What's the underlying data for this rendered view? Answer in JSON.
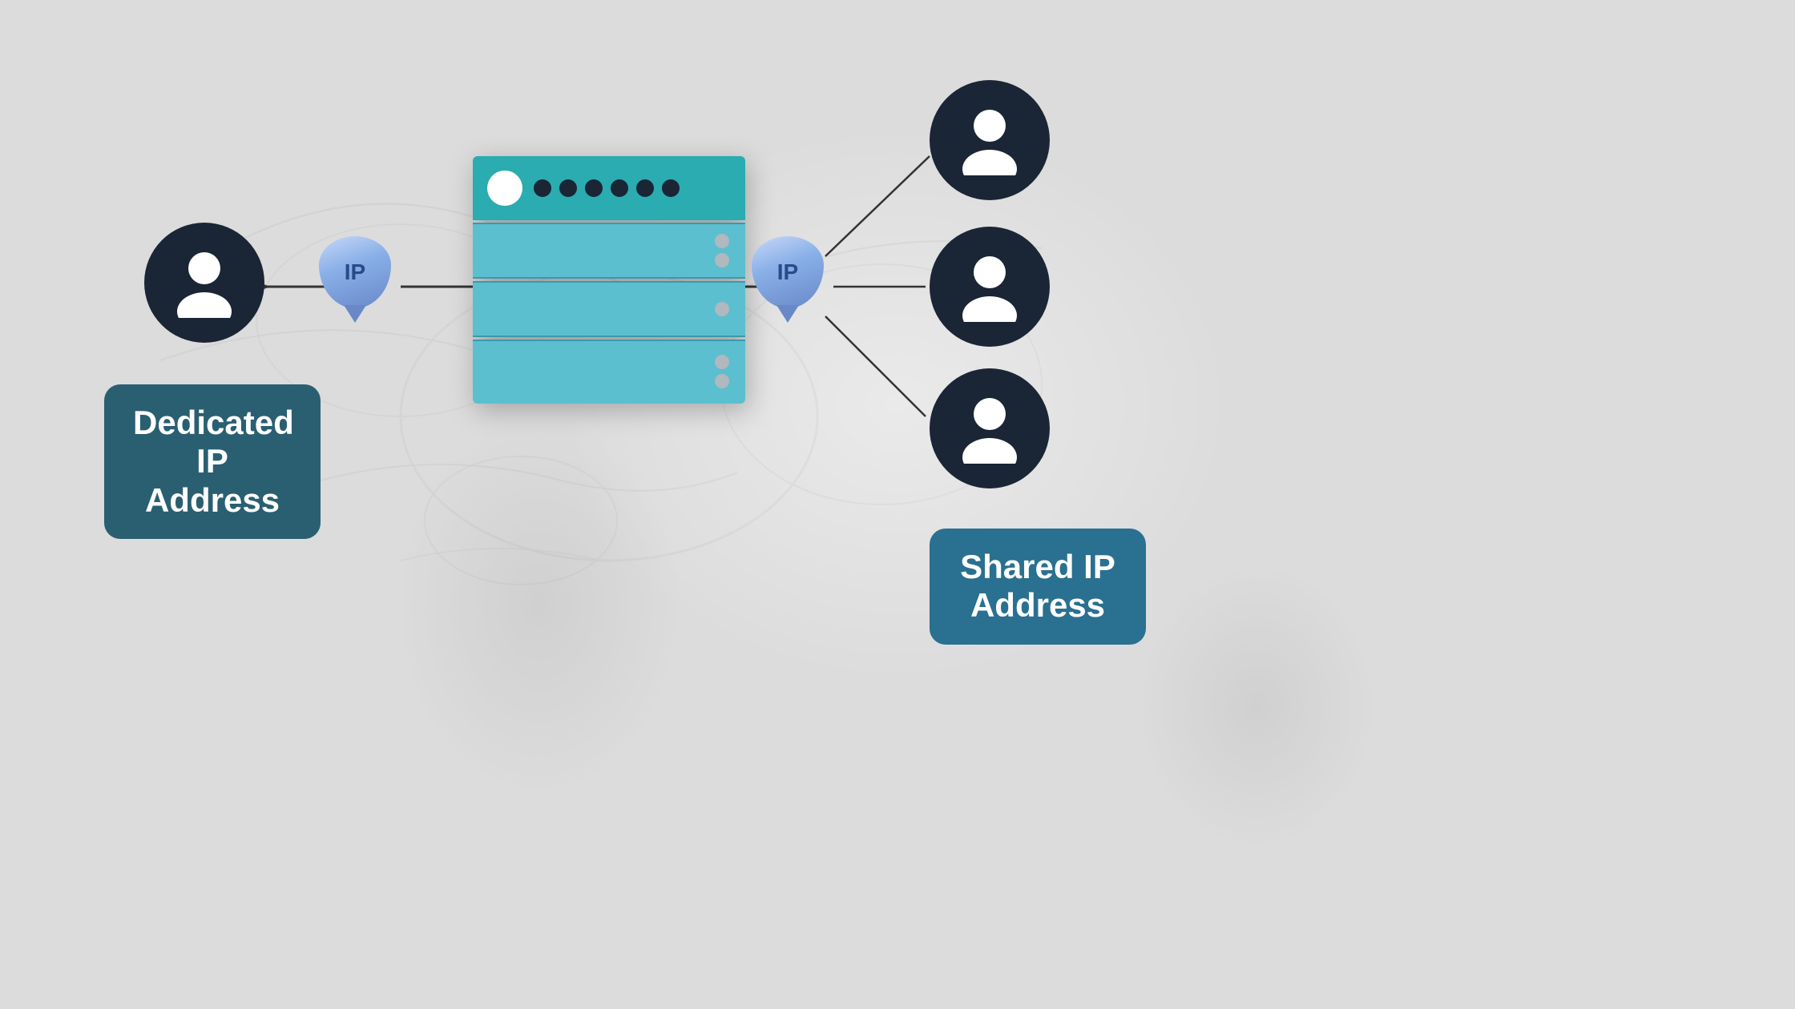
{
  "background": {
    "color": "#dcdcdc"
  },
  "dedicated": {
    "label": "Dedicated IP\nAddress",
    "label_line1": "Dedicated IP",
    "label_line2": "Address"
  },
  "shared": {
    "label": "Shared IP\nAddress",
    "label_line1": "Shared IP",
    "label_line2": "Address"
  },
  "ip_badge_left": "IP",
  "ip_badge_right": "IP",
  "server": {
    "slots": 3,
    "dots": 6
  }
}
